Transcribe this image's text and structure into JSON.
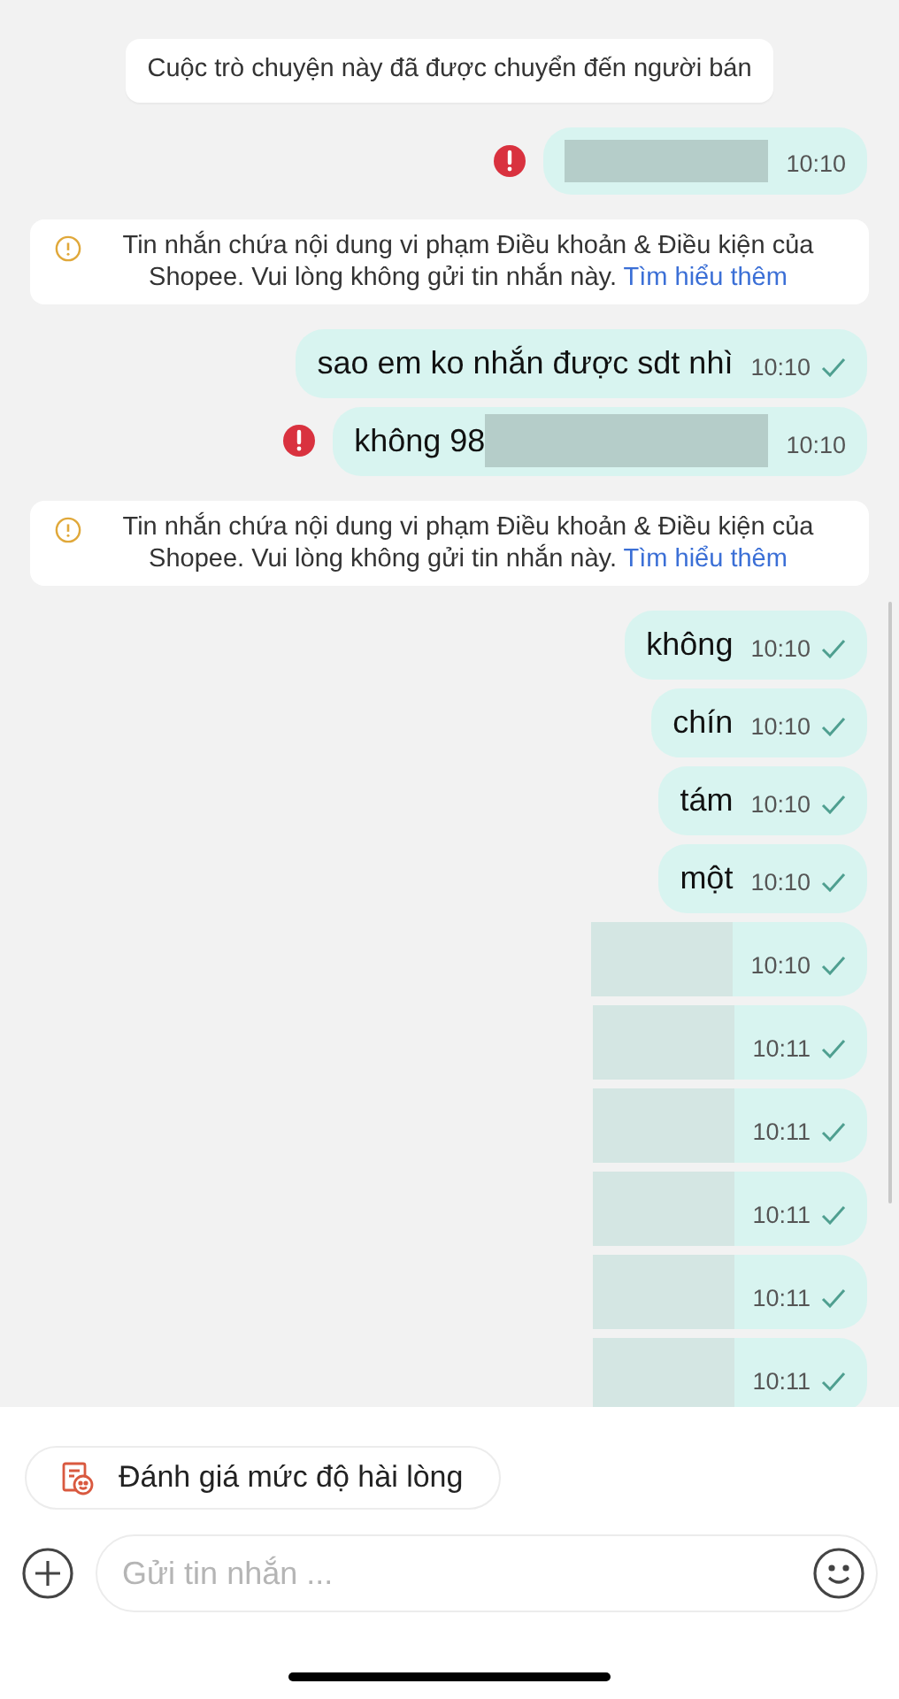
{
  "messages": [
    {
      "kind": "notice",
      "text": "Cuộc trò chuyện này đã được chuyển đến người bán"
    },
    {
      "kind": "message",
      "redacted": true,
      "time": "10:10",
      "failed": true,
      "read": false
    },
    {
      "kind": "warning",
      "text": "Tin nhắn chứa nội dung vi phạm Điều khoản & Điều kiện của Shopee. Vui lòng không gửi tin nhắn này.",
      "link": "Tìm hiểu thêm"
    },
    {
      "kind": "message",
      "text_before_redaction": "sao em ko nhắn được sdt nhì",
      "redacted": false,
      "time": "10:10",
      "failed": false,
      "read": true
    },
    {
      "kind": "message",
      "text_before_redaction": "không 98",
      "redacted": true,
      "time": "10:10",
      "failed": true,
      "read": false
    },
    {
      "kind": "warning",
      "text": "Tin nhắn chứa nội dung vi phạm Điều khoản & Điều kiện của Shopee. Vui lòng không gửi tin nhắn này.",
      "link": "Tìm hiểu thêm"
    },
    {
      "kind": "message",
      "text_before_redaction": "không",
      "redacted": false,
      "time": "10:10",
      "failed": false,
      "read": true
    },
    {
      "kind": "message",
      "text_before_redaction": "chín",
      "redacted": false,
      "time": "10:10",
      "failed": false,
      "read": true
    },
    {
      "kind": "message",
      "text_before_redaction": "tám",
      "redacted": false,
      "time": "10:10",
      "failed": false,
      "read": true
    },
    {
      "kind": "message",
      "text_before_redaction": "một",
      "redacted": false,
      "time": "10:10",
      "failed": false,
      "read": true
    },
    {
      "kind": "message",
      "redacted": true,
      "time": "10:10",
      "failed": false,
      "read": true
    },
    {
      "kind": "message",
      "redacted": true,
      "time": "10:11",
      "failed": false,
      "read": true
    },
    {
      "kind": "message",
      "redacted": true,
      "time": "10:11",
      "failed": false,
      "read": true
    },
    {
      "kind": "message",
      "redacted": true,
      "time": "10:11",
      "failed": false,
      "read": true
    },
    {
      "kind": "message",
      "redacted": true,
      "time": "10:11",
      "failed": false,
      "read": true
    },
    {
      "kind": "message",
      "redacted": true,
      "time": "10:11",
      "failed": false,
      "read": true
    }
  ],
  "rating_button": {
    "label": "Đánh giá mức độ hài lòng"
  },
  "composer": {
    "placeholder": "Gửi tin nhắn ..."
  }
}
